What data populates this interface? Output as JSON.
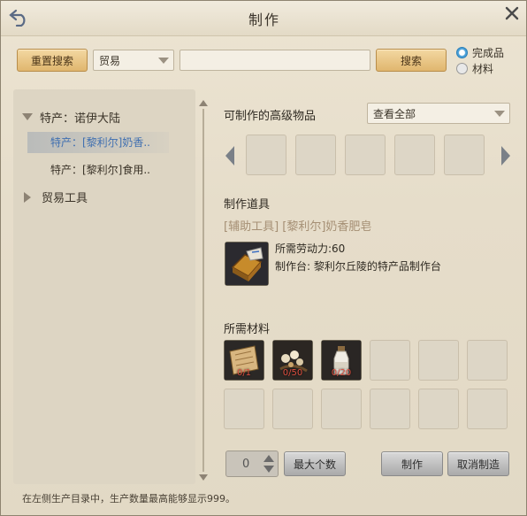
{
  "window": {
    "title": "制作"
  },
  "toolbar": {
    "reset_label": "重置搜索",
    "category_value": "贸易",
    "search_value": "",
    "search_label": "搜索",
    "radio_finished": "完成品",
    "radio_material": "材料"
  },
  "tree": {
    "group1": "特产：诺伊大陆",
    "item1": "特产：[黎利尔]奶香..",
    "item2": "特产：[黎利尔]食用..",
    "group2": "贸易工具"
  },
  "main": {
    "advanced_title": "可制作的高级物品",
    "filter_value": "查看全部",
    "tool_title": "制作道具",
    "tool_name": "[辅助工具] [黎利尔]奶香肥皂",
    "labor": "所需劳动力:60",
    "workbench": "制作台: 黎利尔丘陵的特产品制作台",
    "materials_title": "所需材料",
    "materials": [
      {
        "qty": "0/1",
        "icon": "parchment-icon"
      },
      {
        "qty": "0/50",
        "icon": "flower-herb-icon"
      },
      {
        "qty": "0/20",
        "icon": "milk-bottle-icon"
      }
    ]
  },
  "bottom": {
    "quantity": "0",
    "max_label": "最大个数",
    "craft_label": "制作",
    "cancel_label": "取消制造",
    "hint": "在左侧生产目录中，生产数量最高能够显示999。"
  },
  "colors": {
    "accent_gold": "#e0b66e",
    "selected_text": "#3f6fb0",
    "qty_red": "#e05040"
  }
}
